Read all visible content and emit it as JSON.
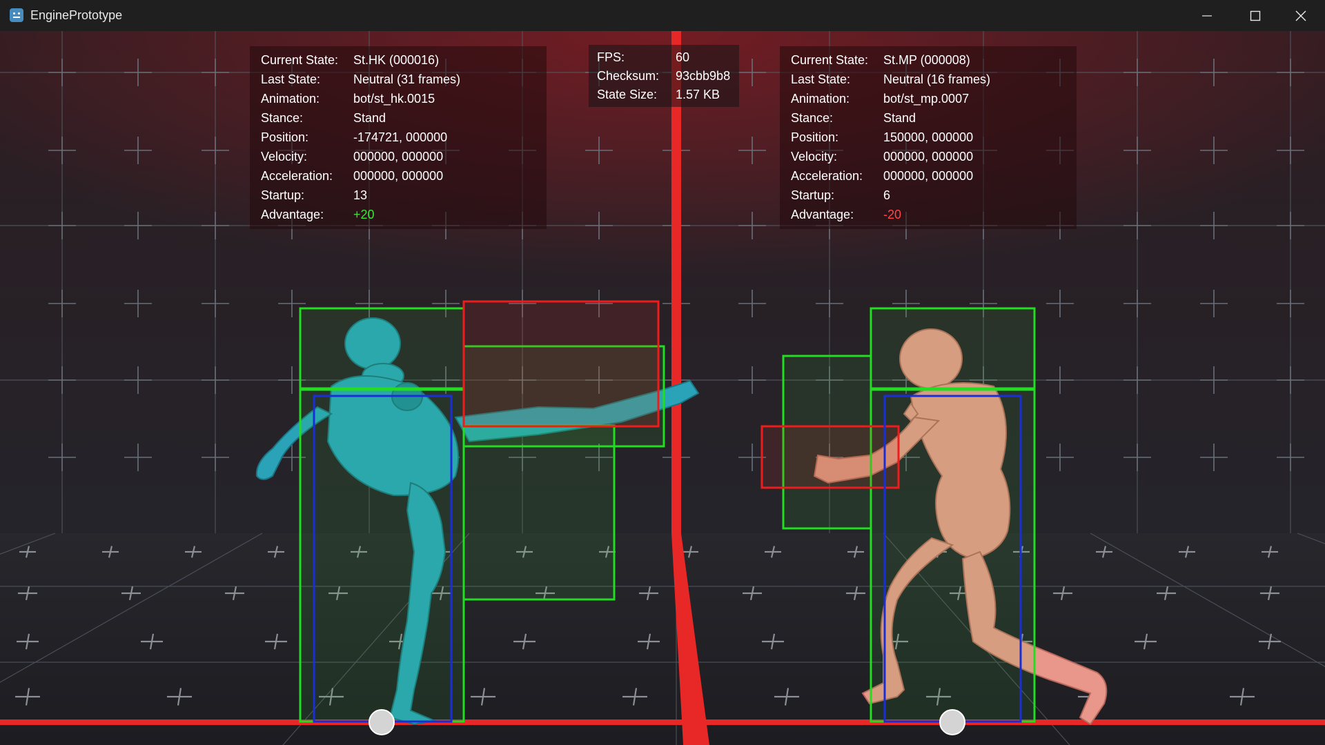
{
  "window": {
    "title": "EnginePrototype",
    "icon": "godot-engine-icon"
  },
  "window_controls": [
    "minimize-icon",
    "maximize-icon",
    "close-icon"
  ],
  "colors": {
    "advantage_positive": "#39e639",
    "advantage_negative": "#ff4747",
    "hurtbox": "#22dd22",
    "hitbox": "#ee1c1c",
    "pushbox": "#1a2ed8",
    "center_line": "#e82727",
    "player1_model": "#2aa3b8",
    "player2_model": "#e8978a"
  },
  "player1": {
    "labels": [
      "Current State:",
      "Last State:",
      "Animation:",
      "Stance:",
      "Position:",
      "Velocity:",
      "Acceleration:",
      "Startup:",
      "Advantage:"
    ],
    "current_state": "St.HK (000016)",
    "last_state": "Neutral (31 frames)",
    "animation": "bot/st_hk.0015",
    "stance": "Stand",
    "position": "-174721, 000000",
    "velocity": "000000, 000000",
    "acceleration": "000000, 000000",
    "startup": "13",
    "advantage": "+20"
  },
  "player2": {
    "labels": [
      "Current State:",
      "Last State:",
      "Animation:",
      "Stance:",
      "Position:",
      "Velocity:",
      "Acceleration:",
      "Startup:",
      "Advantage:"
    ],
    "current_state": "St.MP (000008)",
    "last_state": "Neutral (16 frames)",
    "animation": "bot/st_mp.0007",
    "stance": "Stand",
    "position": "150000, 000000",
    "velocity": "000000, 000000",
    "acceleration": "000000, 000000",
    "startup": "6",
    "advantage": "-20"
  },
  "global": {
    "labels": [
      "FPS:",
      "Checksum:",
      "State Size:"
    ],
    "fps": "60",
    "checksum": "93cbb9b8",
    "state_size": "1.57 KB"
  }
}
